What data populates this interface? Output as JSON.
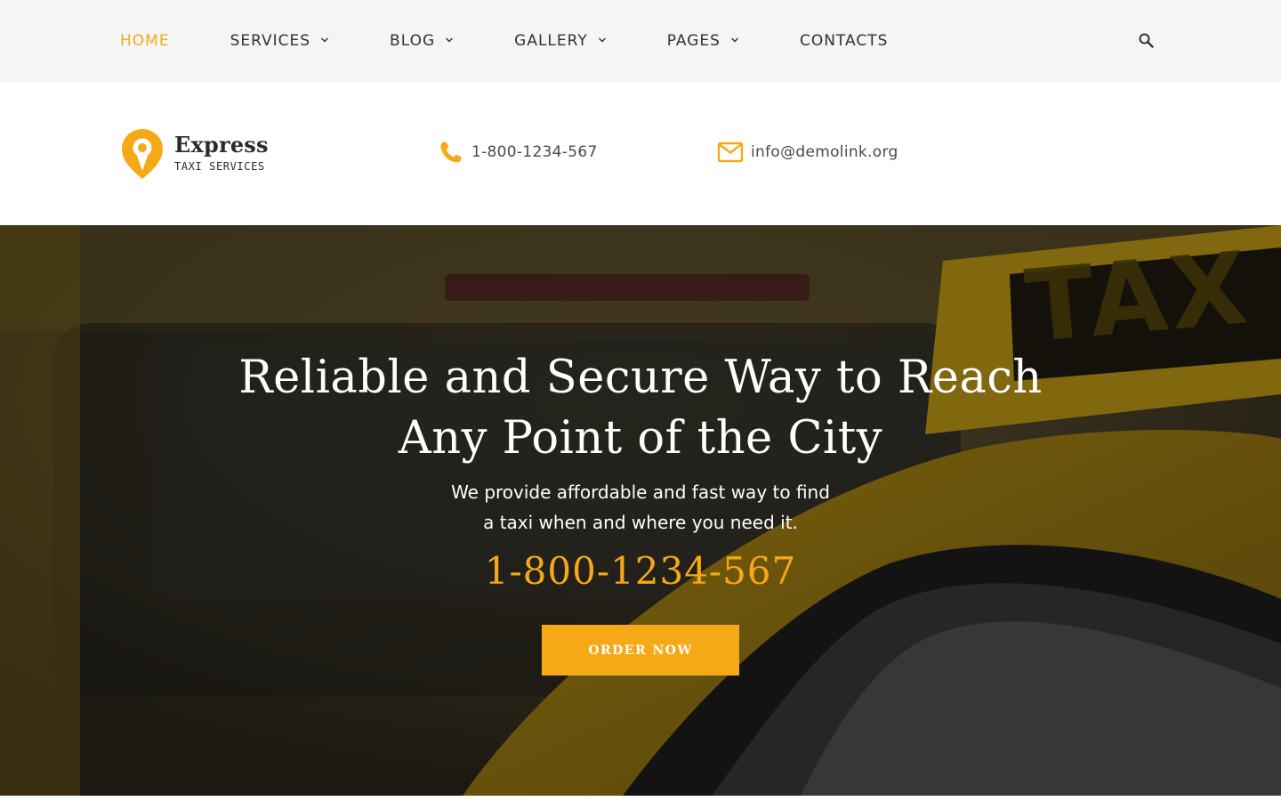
{
  "nav": {
    "items": [
      {
        "label": "HOME",
        "active": true,
        "has_dropdown": false
      },
      {
        "label": "SERVICES",
        "active": false,
        "has_dropdown": true
      },
      {
        "label": "BLOG",
        "active": false,
        "has_dropdown": true
      },
      {
        "label": "GALLERY",
        "active": false,
        "has_dropdown": true
      },
      {
        "label": "PAGES",
        "active": false,
        "has_dropdown": true
      },
      {
        "label": "CONTACTS",
        "active": false,
        "has_dropdown": false
      }
    ],
    "search_icon": "search-icon"
  },
  "header": {
    "logo": {
      "title": "Express",
      "subtitle": "TAXI SERVICES",
      "icon": "map-pin-icon"
    },
    "phone": {
      "icon": "phone-icon",
      "value": "1-800-1234-567"
    },
    "email": {
      "icon": "mail-icon",
      "value": "info@demolink.org"
    }
  },
  "hero": {
    "title_line1": "Reliable and Secure Way to Reach",
    "title_line2": "Any Point of the City",
    "desc_line1": "We provide affordable and fast way to find",
    "desc_line2": "a taxi when and where you need it.",
    "phone": "1-800-1234-567",
    "cta_label": "ORDER NOW",
    "background_sign_text": "TAX"
  },
  "colors": {
    "accent": "#f6a916",
    "nav_bg": "#f5f5f5",
    "text_dark": "#2e3136"
  }
}
